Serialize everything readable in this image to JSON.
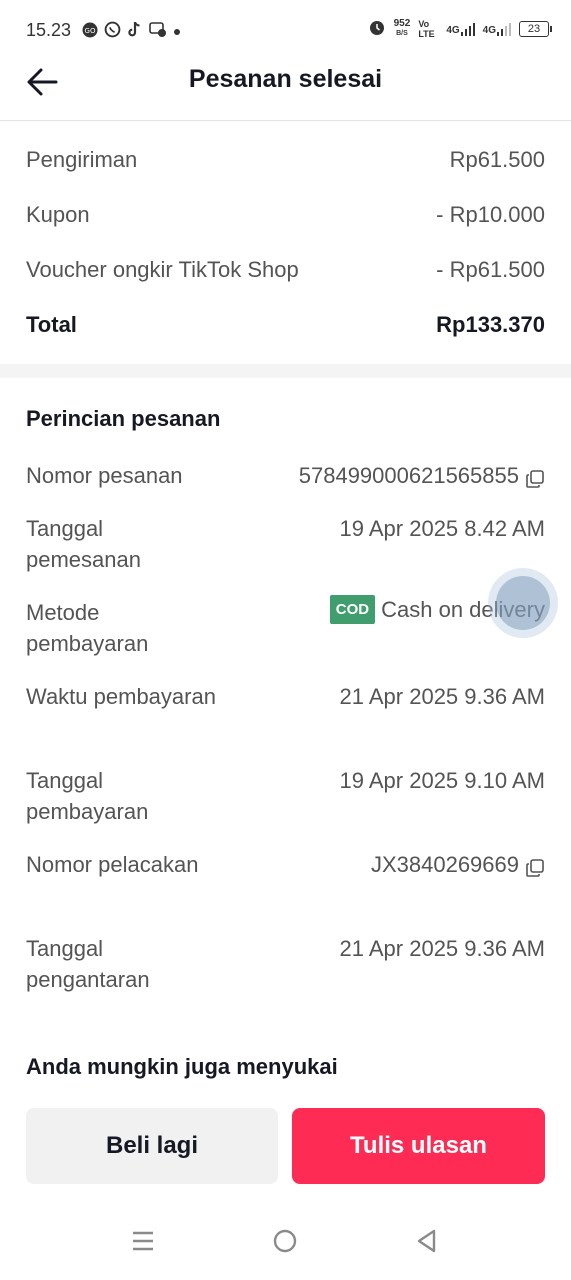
{
  "status_bar": {
    "time": "15.23",
    "net_speed": "952",
    "net_unit": "B/S",
    "volte": "Vo LTE",
    "signal1": "4G",
    "signal2": "4G",
    "battery": "23"
  },
  "header": {
    "title": "Pesanan selesai"
  },
  "summary": [
    {
      "label": "Pengiriman",
      "value": "Rp61.500"
    },
    {
      "label": "Kupon",
      "value": "- Rp10.000"
    },
    {
      "label": "Voucher ongkir TikTok Shop",
      "value": "- Rp61.500"
    },
    {
      "label": "Total",
      "value": "Rp133.370"
    }
  ],
  "details": {
    "title": "Perincian pesanan",
    "order_number": {
      "label": "Nomor pesanan",
      "value": "578499000621565855"
    },
    "order_date": {
      "label": "Tanggal pemesanan",
      "value": "19 Apr 2025 8.42 AM"
    },
    "payment_method": {
      "label": "Metode pembayaran",
      "badge": "COD",
      "value": "Cash on delivery"
    },
    "payment_time": {
      "label": "Waktu pembayaran",
      "value": "21 Apr 2025 9.36 AM"
    },
    "payment_date": {
      "label": "Tanggal pembayaran",
      "value": "19 Apr 2025 9.10 AM"
    },
    "tracking_number": {
      "label": "Nomor pelacakan",
      "value": "JX3840269669"
    },
    "delivery_date": {
      "label": "Tanggal pengantaran",
      "value": "21 Apr 2025 9.36 AM"
    }
  },
  "recommend": {
    "title": "Anda mungkin juga menyukai"
  },
  "actions": {
    "buy_again": "Beli lagi",
    "write_review": "Tulis ulasan"
  },
  "colors": {
    "accent": "#fe2c55",
    "cod": "#3f9d6e"
  }
}
